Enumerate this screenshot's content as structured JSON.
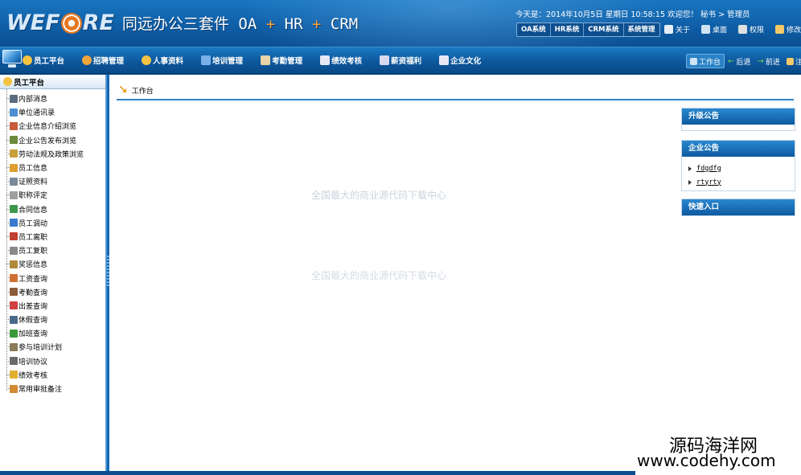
{
  "header": {
    "logo_pre": "WEF",
    "logo_post": "RE",
    "product_name": "同远办公三套件",
    "suite_parts": [
      "OA",
      "HR",
      "CRM"
    ],
    "plus_sign": "+",
    "datetime_line": "今天是：2014年10月5日  星期日  10:58:15  欢迎您！ 秘书 > 管理员",
    "system_tabs": [
      "OA系统",
      "HR系统",
      "CRM系统",
      "系统管理"
    ],
    "links": [
      {
        "label": "关于",
        "icon": "user-icon",
        "color": "#e8eef5"
      },
      {
        "label": "桌面",
        "icon": "desktop-icon",
        "color": "#cfe3f5"
      },
      {
        "label": "权限",
        "icon": "lock-icon",
        "color": "#e0e0e0"
      },
      {
        "label": "修改密码",
        "icon": "key-icon",
        "color": "#f3c969"
      }
    ]
  },
  "nav": {
    "items": [
      {
        "label": "员工平台",
        "icon": "people-icon",
        "color": "#f5c342"
      },
      {
        "label": "招聘管理",
        "icon": "recruit-icon",
        "color": "#f0a43c"
      },
      {
        "label": "人事资料",
        "icon": "profile-icon",
        "color": "#f5c342"
      },
      {
        "label": "培训管理",
        "icon": "training-icon",
        "color": "#7ab0e8"
      },
      {
        "label": "考勤管理",
        "icon": "attendance-icon",
        "color": "#e8d4a8"
      },
      {
        "label": "绩效考核",
        "icon": "pencil-icon",
        "color": "#e8e8f5"
      },
      {
        "label": "薪资福利",
        "icon": "salary-icon",
        "color": "#d8d8f0"
      },
      {
        "label": "企业文化",
        "icon": "culture-icon",
        "color": "#e8e8f5"
      }
    ],
    "right": [
      {
        "label": "工作台",
        "icon": "workbench-icon",
        "color": "#cfe3f5"
      },
      {
        "label": "后退",
        "icon": "back-arrow-icon",
        "color": "#7ad04a"
      },
      {
        "label": "前进",
        "icon": "forward-arrow-icon",
        "color": "#7ad04a"
      },
      {
        "label": "注销",
        "icon": "logout-icon",
        "color": "#f3c969"
      }
    ]
  },
  "sidebar": {
    "title": "员工平台",
    "items": [
      {
        "label": "内部消息",
        "icon": "message-icon",
        "color": "#5a6a80"
      },
      {
        "label": "单位通讯录",
        "icon": "addressbook-icon",
        "color": "#4a90d0"
      },
      {
        "label": "企业信息介绍浏览",
        "icon": "info-icon",
        "color": "#c85a3a"
      },
      {
        "label": "企业公告发布浏览",
        "icon": "notice-icon",
        "color": "#6a8a3a"
      },
      {
        "label": "劳动法规及政策浏览",
        "icon": "law-icon",
        "color": "#c8a03a"
      },
      {
        "label": "员工信息",
        "icon": "employee-icon",
        "color": "#e0a030"
      },
      {
        "label": "证照资料",
        "icon": "license-icon",
        "color": "#7a8a9a"
      },
      {
        "label": "职称评定",
        "icon": "title-icon",
        "color": "#a0a0a0"
      },
      {
        "label": "合同信息",
        "icon": "contract-icon",
        "color": "#3a9a4a"
      },
      {
        "label": "员工调动",
        "icon": "transfer-icon",
        "color": "#3a7ad0"
      },
      {
        "label": "员工离职",
        "icon": "resign-icon",
        "color": "#c04030"
      },
      {
        "label": "员工复职",
        "icon": "rehire-icon",
        "color": "#8a8a8a"
      },
      {
        "label": "奖惩信息",
        "icon": "reward-icon",
        "color": "#b08a3a"
      },
      {
        "label": "工资查询",
        "icon": "wage-icon",
        "color": "#d07030"
      },
      {
        "label": "考勤查询",
        "icon": "attendance-query-icon",
        "color": "#8a5a3a"
      },
      {
        "label": "出差查询",
        "icon": "trip-icon",
        "color": "#d04040"
      },
      {
        "label": "休假查询",
        "icon": "leave-icon",
        "color": "#4a6a8a"
      },
      {
        "label": "加班查询",
        "icon": "overtime-icon",
        "color": "#3a9a3a"
      },
      {
        "label": "参与培训计划",
        "icon": "plan-icon",
        "color": "#8a7a5a"
      },
      {
        "label": "培训协议",
        "icon": "agreement-icon",
        "color": "#6a6a6a"
      },
      {
        "label": "绩效考核",
        "icon": "performance-icon",
        "color": "#e0b030"
      },
      {
        "label": "常用审批备注",
        "icon": "approval-icon",
        "color": "#d08a30"
      }
    ]
  },
  "main": {
    "breadcrumb": "工作台",
    "watermark": "全国最大的商业源代码下载中心",
    "panels": [
      {
        "title": "升级公告",
        "links": []
      },
      {
        "title": "企业公告",
        "links": [
          "fdgdfg",
          "rtyrty"
        ]
      },
      {
        "title": "快速入口",
        "links": []
      }
    ]
  },
  "site_mark": {
    "name": "源码海洋网",
    "url": "www.codehy.com"
  },
  "colors": {
    "brand_blue": "#0f5fa8",
    "accent_orange": "#e87722",
    "panel_header": "#1568b3"
  }
}
